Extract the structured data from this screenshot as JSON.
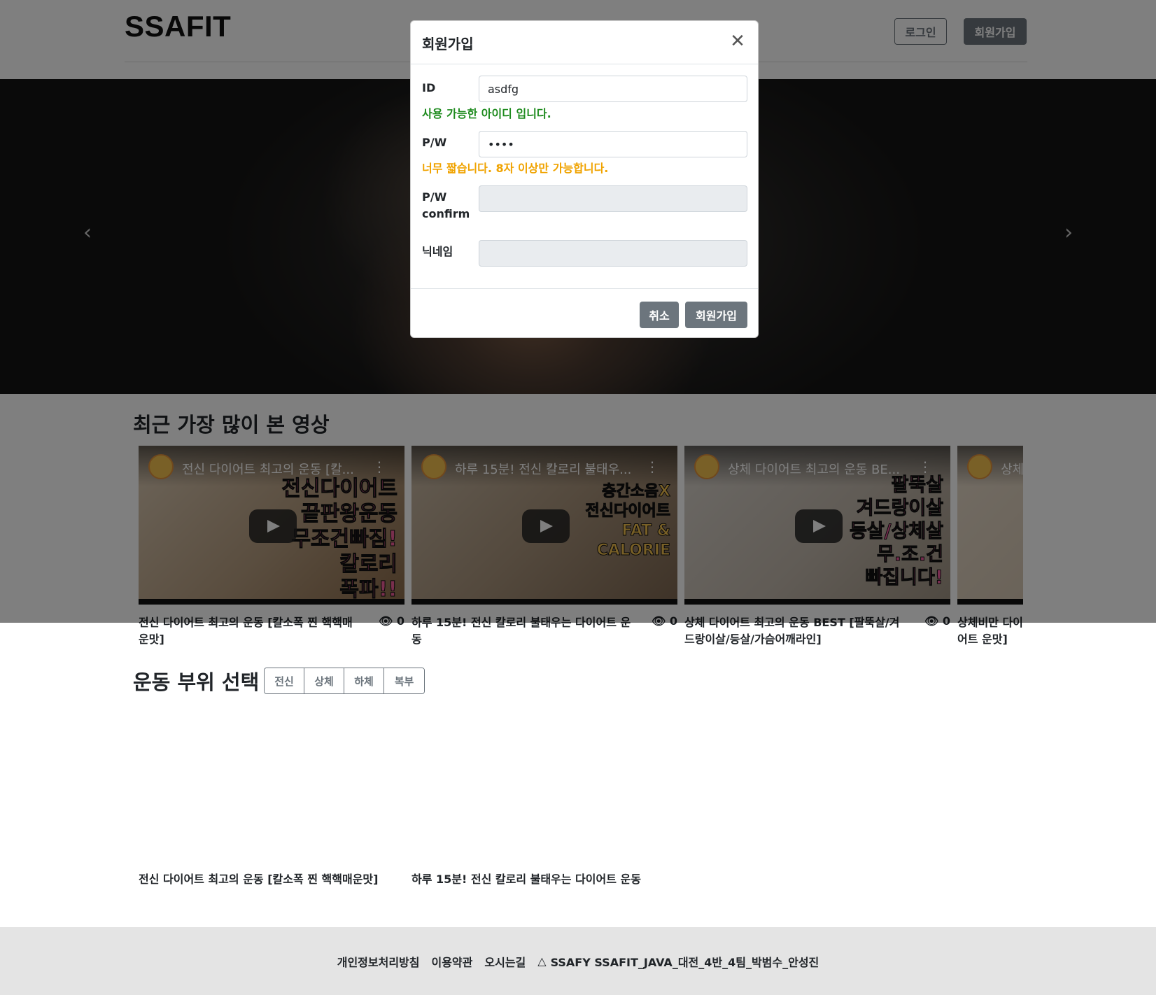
{
  "header": {
    "logo": "SSAFIT",
    "login_label": "로그인",
    "signup_label": "회원가입"
  },
  "carousel": {
    "prev_icon": "chevron-left-icon",
    "next_icon": "chevron-right-icon"
  },
  "recent": {
    "title": "최근 가장 많이 본 영상",
    "videos": [
      {
        "thumb_title": "전신 다이어트 최고의 운동 [칼...",
        "thumb_text": "전신다이어트\n끝판왕운동\n무조건빠짐!\n칼로리\n폭파!!",
        "title": "전신 다이어트 최고의 운동 [칼소폭 찐 핵핵매운맛]",
        "views": "0"
      },
      {
        "thumb_title": "하루 15분! 전신 칼로리 불태우...",
        "thumb_text": "층간소음X\n전신다이어트\nFAT &\nCALORIE",
        "title": "하루 15분! 전신 칼로리 불태우는 다이어트 운동",
        "views": "0"
      },
      {
        "thumb_title": "상체 다이어트 최고의 운동 BE...",
        "thumb_text": "팔뚝살\n겨드랑이살\n등살/상체살\n무.조.건\n빠집니다!",
        "title": "상체 다이어트 최고의 운동 BEST [팔뚝살/겨드랑이살/등살/가슴어깨라인]",
        "views": "0"
      },
      {
        "thumb_title": "상체",
        "thumb_text": "",
        "title": "상체비만 다이어트 운맛]",
        "views": ""
      }
    ]
  },
  "part": {
    "title": "운동 부위 선택",
    "tabs": [
      "전신",
      "상체",
      "하체",
      "복부"
    ],
    "videos": [
      {
        "title": "전신 다이어트 최고의 운동 [칼소폭 찐 핵핵매운맛]"
      },
      {
        "title": "하루 15분! 전신 칼로리 불태우는 다이어트 운동"
      }
    ]
  },
  "footer": {
    "privacy": "개인정보처리방침",
    "terms": "이용약관",
    "directions": "오시는길",
    "copyright": "SSAFY SSAFIT_JAVA_대전_4반_4팀_박범수_안성진"
  },
  "modal": {
    "title": "회원가입",
    "id_label": "ID",
    "id_value": "asdfg",
    "id_message": "사용 가능한 아이디 입니다.",
    "pw_label": "P/W",
    "pw_value": "••••",
    "pw_message": "너무 짧습니다. 8자 이상만 가능합니다.",
    "pwc_label": "P/W confirm",
    "pwc_value": "",
    "nick_label": "닉네임",
    "nick_value": "",
    "cancel_label": "취소",
    "submit_label": "회원가입"
  },
  "colors": {
    "secondary": "#6c757d",
    "success": "#1e8b1e",
    "warning": "#f0a300",
    "footer_bg": "#e4e4e4"
  }
}
